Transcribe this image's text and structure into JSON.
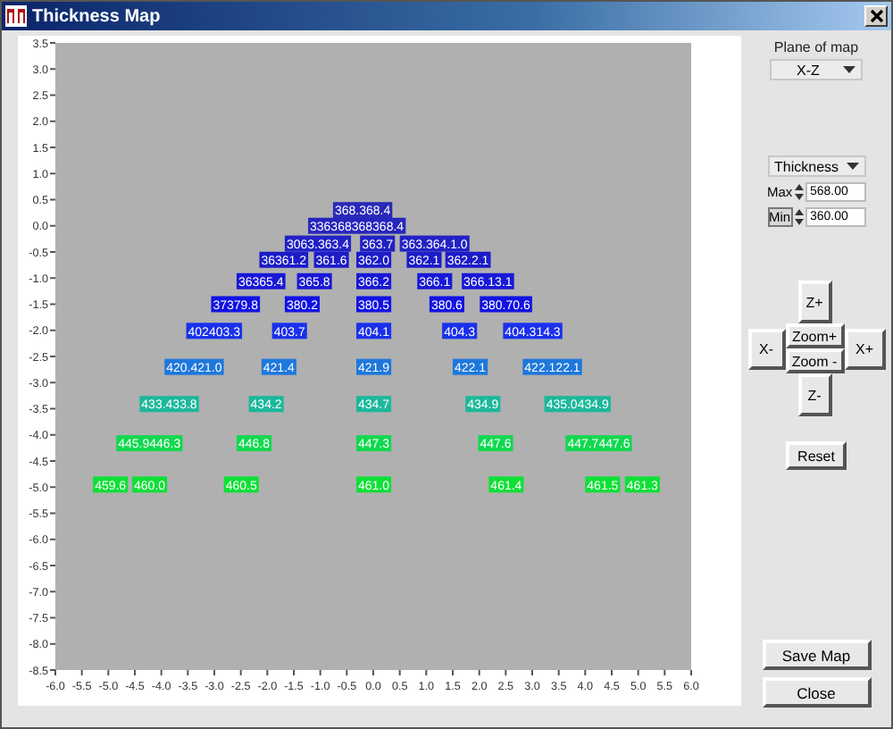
{
  "window": {
    "title": "Thickness Map"
  },
  "map": {
    "y_axis": [
      "3.5",
      "3.0",
      "2.5",
      "2.0",
      "1.5",
      "1.0",
      "0.5",
      "0.0",
      "-0.5",
      "-1.0",
      "-1.5",
      "-2.0",
      "-2.5",
      "-3.0",
      "-3.5",
      "-4.0",
      "-4.5",
      "-5.0",
      "-5.5",
      "-6.0",
      "-6.5",
      "-7.0",
      "-7.5",
      "-8.0",
      "-8.5"
    ],
    "x_axis": [
      "-6.0",
      "-5.5",
      "-5.0",
      "-4.5",
      "-4.0",
      "-3.5",
      "-3.0",
      "-2.5",
      "-2.0",
      "-1.5",
      "-1.0",
      "-0.5",
      "0.0",
      "0.5",
      "1.0",
      "1.5",
      "2.0",
      "2.5",
      "3.0",
      "3.5",
      "4.0",
      "4.5",
      "5.0",
      "5.5",
      "6.0"
    ],
    "rows": [
      {
        "color": "#2a2ab8",
        "markers": [
          "368.368.4"
        ]
      },
      {
        "color": "#2626bc",
        "markers": [
          "336368368368.4"
        ]
      },
      {
        "color": "#2222c4",
        "markers": [
          "3063.363.4",
          "363.7",
          "363.364.1.0"
        ]
      },
      {
        "color": "#1c1cc8",
        "markers": [
          "36361.2",
          "361.6",
          "362.0",
          "362.1",
          "362.2.1"
        ]
      },
      {
        "color": "#1818d8",
        "markers": [
          "36365.4",
          "365.8",
          "366.2",
          "366.1",
          "366.13.1"
        ]
      },
      {
        "color": "#1212e4",
        "markers": [
          "37379.8",
          "380.2",
          "380.5",
          "380.6",
          "380.70.6"
        ]
      },
      {
        "color": "#1a30ec",
        "markers": [
          "402403.3",
          "403.7",
          "404.1",
          "404.3",
          "404.314.3"
        ]
      },
      {
        "color": "#1e78dc",
        "markers": [
          "420.421.0",
          "421.4",
          "421.9",
          "422.1",
          "422.122.1"
        ]
      },
      {
        "color": "#1cb89a",
        "markers": [
          "433.433.8",
          "434.2",
          "434.7",
          "434.9",
          "435.0434.9"
        ]
      },
      {
        "color": "#12d850",
        "markers": [
          "445.9446.3",
          "446.8",
          "447.3",
          "447.6",
          "447.7447.6"
        ]
      },
      {
        "color": "#10e036",
        "markers": [
          "459.6",
          "460.0",
          "460.5",
          "461.0",
          "461.4",
          "461.5",
          "461.3"
        ]
      }
    ]
  },
  "plane": {
    "label": "Plane of map",
    "value": "X-Z"
  },
  "quantity": {
    "value": "Thickness"
  },
  "limits": [
    {
      "label": "Max",
      "value": "568.00",
      "focused": false
    },
    {
      "label": "Min",
      "value": "360.00",
      "focused": true
    }
  ],
  "nav": [
    {
      "kind": "z-plus",
      "label": "Z+"
    },
    {
      "kind": "x-minus",
      "label": "X-"
    },
    {
      "kind": "zoom-in",
      "label": "Zoom+"
    },
    {
      "kind": "x-plus",
      "label": "X+"
    },
    {
      "kind": "zoom-out",
      "label": "Zoom -"
    },
    {
      "kind": "z-minus",
      "label": "Z-"
    }
  ],
  "reset": "Reset",
  "actions": [
    "Save Map",
    "Close"
  ]
}
